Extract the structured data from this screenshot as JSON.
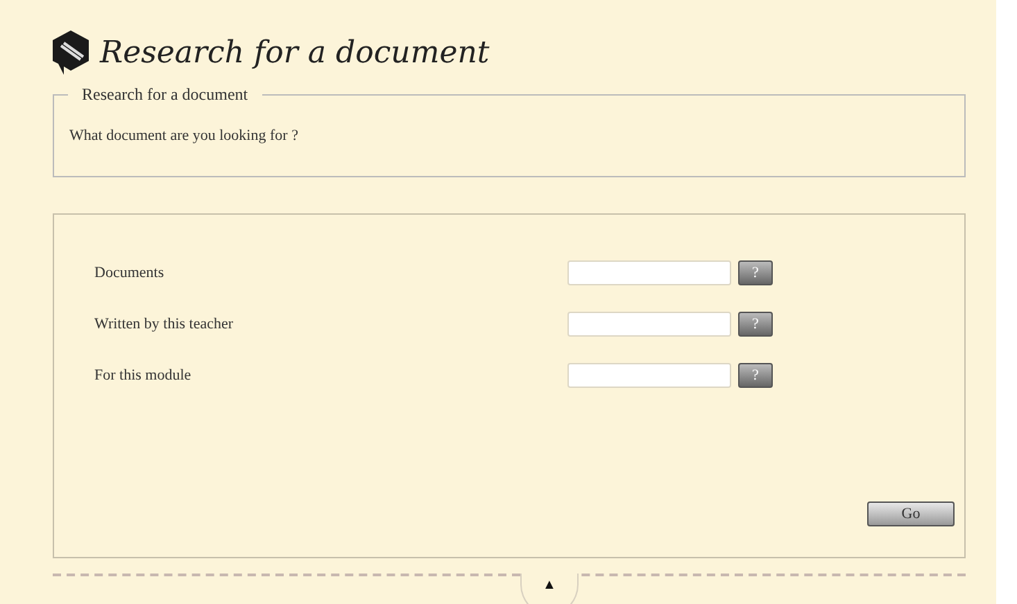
{
  "header": {
    "title": "Research for a document"
  },
  "intro": {
    "legend": "Research for a document",
    "question": "What document are you looking for ?"
  },
  "fields": [
    {
      "label": "Documents",
      "help": "?"
    },
    {
      "label": "Written by this teacher",
      "help": "?"
    },
    {
      "label": "For this module",
      "help": "?"
    }
  ],
  "submit": "Go",
  "toggle": "▲"
}
